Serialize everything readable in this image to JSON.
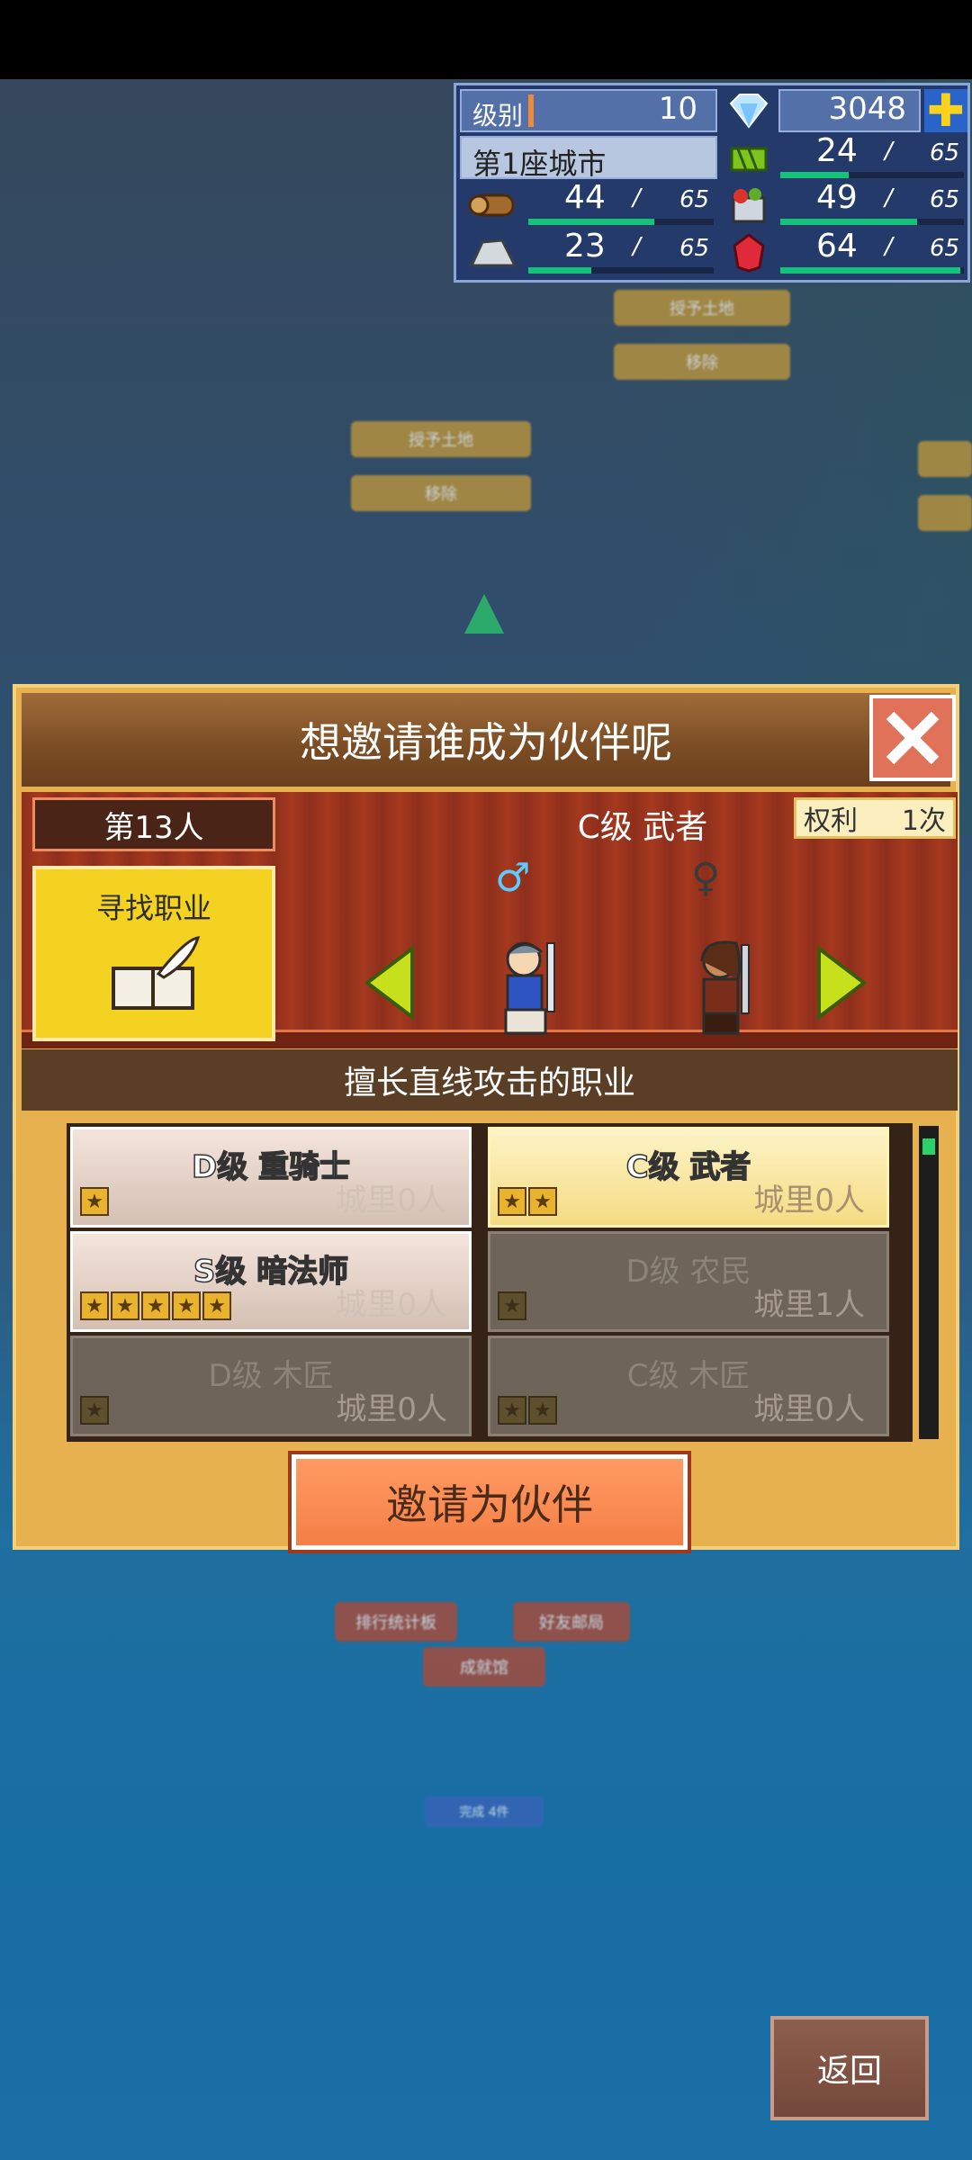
{
  "hud": {
    "level_label": "级别",
    "level_value": "10",
    "gems": "3048",
    "city_name": "第1座城市",
    "resources": [
      {
        "name": "wood",
        "value": "44",
        "max": "65",
        "fill": 0.68
      },
      {
        "name": "grass",
        "value": "24",
        "max": "65",
        "fill": 0.37
      },
      {
        "name": "food",
        "value": "49",
        "max": "65",
        "fill": 0.75
      },
      {
        "name": "ore",
        "value": "23",
        "max": "65",
        "fill": 0.35
      },
      {
        "name": "ruby",
        "value": "64",
        "max": "65",
        "fill": 0.98
      }
    ],
    "separator": "/"
  },
  "background_buttons": {
    "grant_land": "授予土地",
    "remove": "移除",
    "ranking_board": "排行统计板",
    "friend_mail": "好友邮局",
    "achievement_hall": "成就馆",
    "complete_count": "完成 4件"
  },
  "dialog": {
    "title": "想邀请谁成为伙伴呢",
    "person_count": "第13人",
    "find_job": "寻找职业",
    "rights_label": "权利",
    "rights_value": "1次",
    "selected_job": "C级 武者",
    "description": "擅长直线攻击的职业",
    "jobs": [
      {
        "name": "D级 重骑士",
        "count": "城里0人",
        "stars": 1,
        "state": "light"
      },
      {
        "name": "C级 武者",
        "count": "城里0人",
        "stars": 2,
        "state": "active"
      },
      {
        "name": "S级 暗法师",
        "count": "城里0人",
        "stars": 5,
        "state": "light"
      },
      {
        "name": "D级 农民",
        "count": "城里1人",
        "stars": 1,
        "state": "dark"
      },
      {
        "name": "D级 木匠",
        "count": "城里0人",
        "stars": 1,
        "state": "dark"
      },
      {
        "name": "C级 木匠",
        "count": "城里0人",
        "stars": 2,
        "state": "dark"
      }
    ],
    "invite_button": "邀请为伙伴"
  },
  "back_button": "返回"
}
